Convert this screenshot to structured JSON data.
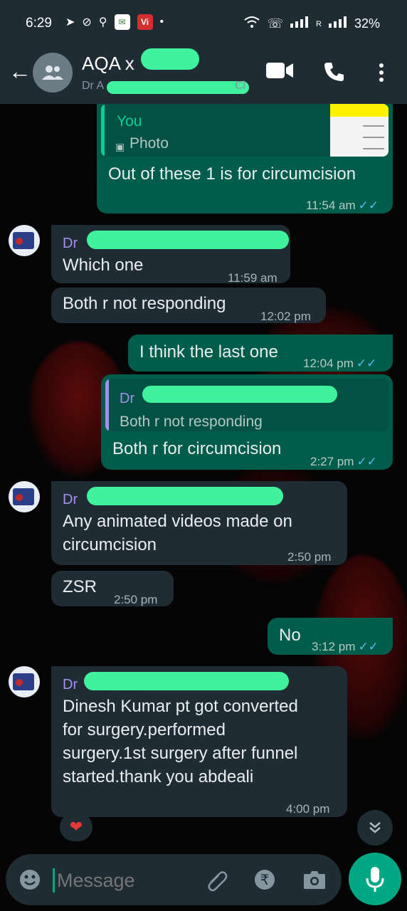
{
  "status_bar": {
    "time": "6:29",
    "battery": "32%",
    "signal_label": "R"
  },
  "header": {
    "name": "AQA x",
    "sub": "Dr A",
    "sub_tail": "Cl"
  },
  "messages": {
    "m1": {
      "quote_author": "You",
      "quote_type": "Photo",
      "text": "Out of these 1 is for circumcision",
      "time": "11:54 am"
    },
    "m2": {
      "sender": "Dr",
      "text": "Which one",
      "time": "11:59 am"
    },
    "m3": {
      "text": "Both r not responding",
      "time": "12:02 pm"
    },
    "m4": {
      "text": "I think the last one",
      "time": "12:04 pm"
    },
    "m5": {
      "quote_author": "Dr",
      "quote_text": "Both r not responding",
      "text": "Both r for circumcision",
      "time": "2:27 pm"
    },
    "m6": {
      "sender": "Dr",
      "line1": "Any animated videos made on",
      "line2": "circumcision",
      "time": "2:50 pm"
    },
    "m7": {
      "text": "ZSR",
      "time": "2:50 pm"
    },
    "m8": {
      "text": "No",
      "time": "3:12 pm"
    },
    "m9": {
      "sender": "Dr",
      "line1": "Dinesh Kumar pt got converted",
      "line2": "for surgery.performed",
      "line3": "surgery.1st surgery after funnel",
      "line4": "started.thank you abdeali",
      "time": "4:00 pm"
    }
  },
  "input": {
    "placeholder": "Message"
  },
  "ticks": "✓✓",
  "reaction": "❤"
}
